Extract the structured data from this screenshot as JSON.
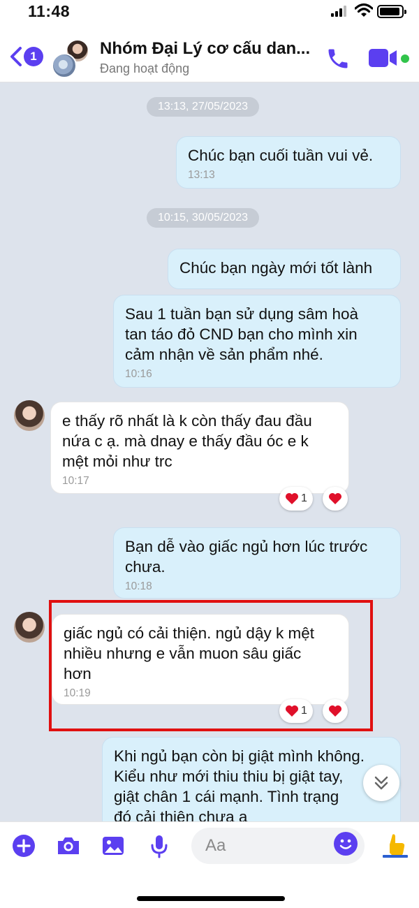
{
  "status_bar": {
    "time": "11:48"
  },
  "header": {
    "back_count": "1",
    "title": "Nhóm Đại Lý cơ cấu dan...",
    "status": "Đang hoạt động"
  },
  "colors": {
    "accent": "#5b3ff0",
    "online": "#31c44b",
    "outgoing_bubble": "#d9f0fb",
    "chat_background": "#dde3ec",
    "highlight_border": "#e01010",
    "heart": "#e0102a"
  },
  "messages": [
    {
      "type": "timestamp",
      "text": "13:13, 27/05/2023"
    },
    {
      "type": "outgoing",
      "text": "Chúc bạn cuối tuần vui vẻ.",
      "time": "13:13"
    },
    {
      "type": "timestamp",
      "text": "10:15, 30/05/2023"
    },
    {
      "type": "outgoing",
      "text": "Chúc bạn ngày mới tốt lành"
    },
    {
      "type": "outgoing",
      "lines": [
        "Sau 1 tuần bạn sử dụng sâm hoà",
        "tan táo đỏ CND bạn cho mình xin",
        "cảm nhận về sản phẩm nhé."
      ],
      "time": "10:16"
    },
    {
      "type": "incoming",
      "lines": [
        "e thấy rõ nhất là k còn thấy đau đầu",
        "nứa c ạ. mà dnay e thấy đầu óc e k",
        "mệt mỏi như trc"
      ],
      "time": "10:17",
      "reaction_count": "1"
    },
    {
      "type": "outgoing",
      "lines": [
        "Bạn dễ vào giấc ngủ hơn lúc trước",
        "chưa."
      ],
      "time": "10:18"
    },
    {
      "type": "incoming",
      "lines": [
        "giấc ngủ có cải thiện. ngủ dậy k mệt",
        "nhiều nhưng e vẫn muon sâu giấc",
        "hơn"
      ],
      "time": "10:19",
      "reaction_count": "1",
      "highlighted": true
    },
    {
      "type": "outgoing",
      "lines": [
        "Khi ngủ bạn còn bị giật mình không.",
        "Kiểu như mới thiu thiu bị giật tay,",
        "giật chân 1 cái mạnh. Tình trạng",
        "đó cải thiện chưa a"
      ]
    }
  ],
  "composer": {
    "placeholder": "Aa",
    "icons": [
      "plus-icon",
      "camera-icon",
      "image-icon",
      "microphone-icon",
      "emoji-icon",
      "thumbs-up-icon"
    ]
  }
}
